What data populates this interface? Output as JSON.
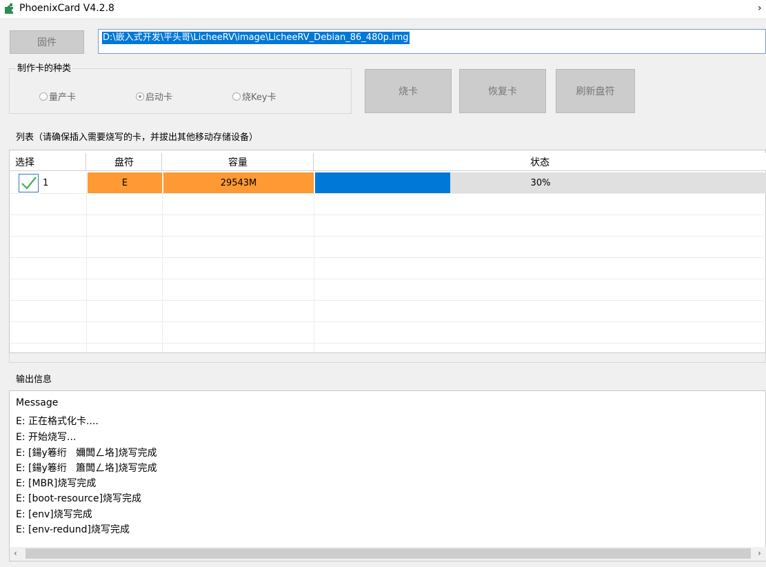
{
  "window": {
    "title": "PhoenixCard V4.2.8"
  },
  "firmware": {
    "button_label": "固件",
    "path": "D:\\嵌入式开发\\平头哥\\LicheeRV\\image\\LicheeRV_Debian_86_480p.img"
  },
  "card_type": {
    "group_label": "制作卡的种类",
    "options": [
      {
        "label": "量产卡",
        "selected": false
      },
      {
        "label": "启动卡",
        "selected": true
      },
      {
        "label": "烧Key卡",
        "selected": false
      }
    ]
  },
  "actions": {
    "burn": "烧卡",
    "restore": "恢复卡",
    "refresh": "刷新盘符"
  },
  "list": {
    "group_label": "列表（请确保插入需要烧写的卡，并拔出其他移动存储设备）",
    "columns": [
      "选择",
      "盘符",
      "容量",
      "状态"
    ],
    "rows": [
      {
        "select_index": "1",
        "checked": true,
        "drive": "E",
        "capacity": "29543M",
        "status_text": "30%",
        "progress": 0.3
      }
    ]
  },
  "output": {
    "group_label": "输出信息",
    "lines": [
      "Message",
      "E: 正在格式化卡....",
      "E: 开始烧写...",
      "E: [鍚у箞绗   嬭闆ㄥ垎]烧写完成",
      "E: [鍚у箞绗   簫闆ㄥ垎]烧写完成",
      "E: [MBR]烧写完成",
      "E: [boot-resource]烧写完成",
      "E: [env]烧写完成",
      "E: [env-redund]烧写完成"
    ]
  },
  "colors": {
    "selection": "#0078d7",
    "row_highlight": "#ff9933",
    "progress_fill": "#0078d7"
  },
  "icons": {
    "app": "puzzle-icon",
    "title_chevron": "chevron-right-icon",
    "check": "check-icon",
    "scroll_left": "arrow-left-icon",
    "scroll_right": "arrow-right-icon"
  }
}
